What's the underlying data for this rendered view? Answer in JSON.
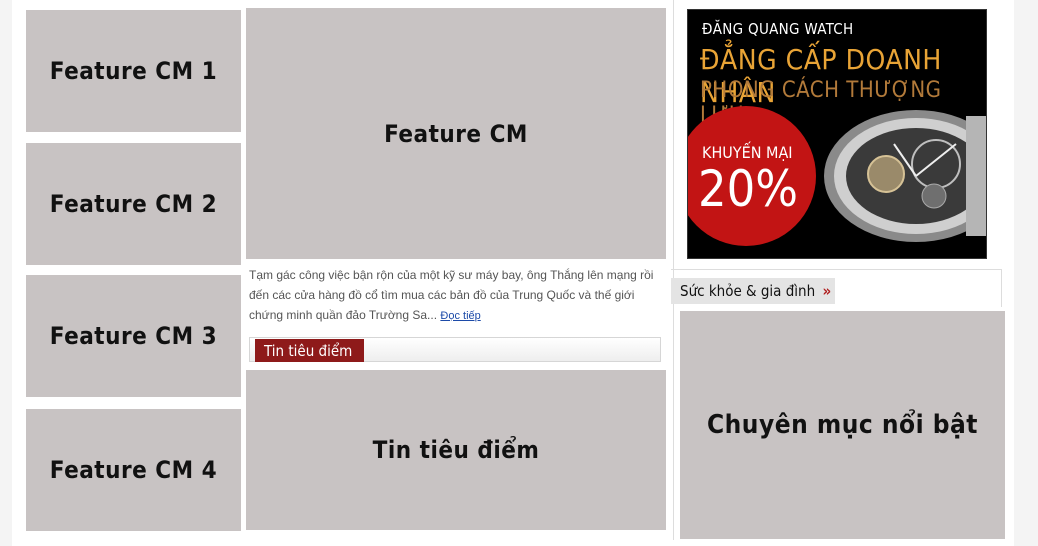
{
  "features": {
    "cm1": "Feature CM 1",
    "cm2": "Feature CM 2",
    "cm3": "Feature CM 3",
    "cm4": "Feature CM 4",
    "main": "Feature CM"
  },
  "excerpt": {
    "text": "Tạm gác công việc bận rộn của một kỹ sư máy bay, ông Thắng lên mạng rồi đến các cửa hàng đồ cổ tìm mua các bản đồ của Trung Quốc và thế giới chứng minh quần đảo Trường Sa...",
    "read_more": "Đọc tiếp"
  },
  "highlights": {
    "tab_label": "Tin tiêu điểm",
    "placeholder": "Tin tiêu điểm"
  },
  "ad": {
    "brand": "ĐĂNG QUANG WATCH",
    "line1": "ĐẲNG CẤP DOANH NHÂN",
    "line2": "PHONG CÁCH THƯỢNG LƯU",
    "promo_label": "KHUYẾN MẠI",
    "promo_value": "20%"
  },
  "category": {
    "title": "Sức khỏe & gia đình",
    "arrow": "»",
    "placeholder": "Chuyên mục nổi bật"
  },
  "colors": {
    "placeholder_bg": "#c8c3c3",
    "tab_bg": "#8e1a1a",
    "promo_red": "#c21414",
    "gold": "#e9a436"
  }
}
